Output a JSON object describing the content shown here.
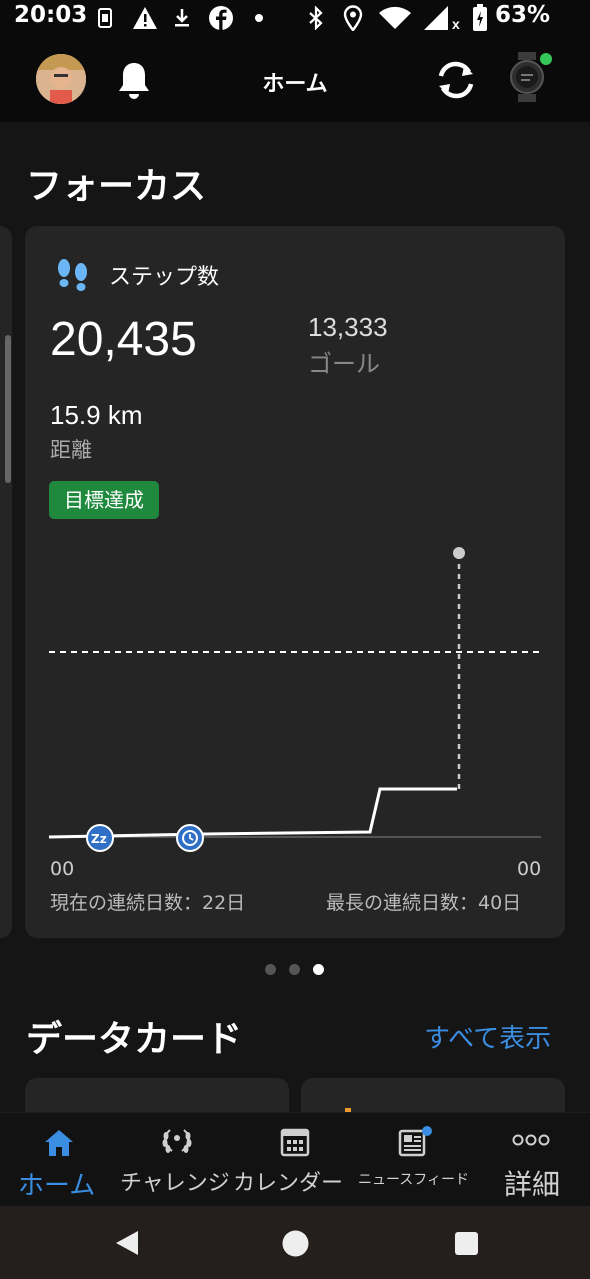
{
  "status_bar": {
    "time": "20:03",
    "battery": "63%",
    "icons": [
      "sim-icon",
      "warning-icon",
      "download-icon",
      "facebook-icon",
      "dot-icon",
      "bluetooth-icon",
      "location-icon",
      "wifi-icon",
      "signal-icon",
      "battery-icon"
    ]
  },
  "header": {
    "title": "ホーム"
  },
  "focus": {
    "title": "フォーカス",
    "card": {
      "metric_label": "ステップ数",
      "value": "20,435",
      "goal_value": "13,333",
      "goal_label": "ゴール",
      "distance": "15.9 km",
      "distance_label": "距離",
      "badge": "目標達成",
      "chart_left": "00",
      "chart_right": "00",
      "streak_current": "現在の連続日数：22日",
      "streak_longest": "最長の連続日数：40日"
    },
    "pager": {
      "count": 3,
      "active": 2
    }
  },
  "data_cards": {
    "title": "データカード",
    "show_all": "すべて表示"
  },
  "bottom_nav": [
    {
      "label": "ホーム",
      "icon": "home-icon",
      "active": true
    },
    {
      "label": "チャレンジ",
      "icon": "laurel-icon",
      "active": false
    },
    {
      "label": "カレンダー",
      "icon": "calendar-icon",
      "active": false
    },
    {
      "label": "ニュースフィード",
      "icon": "newsfeed-icon",
      "active": false
    },
    {
      "label": "詳細",
      "icon": "more-icon",
      "active": false
    }
  ],
  "colors": {
    "accent": "#3a8de0",
    "goal_green": "#1f8a3e",
    "card_bg": "#252525"
  }
}
